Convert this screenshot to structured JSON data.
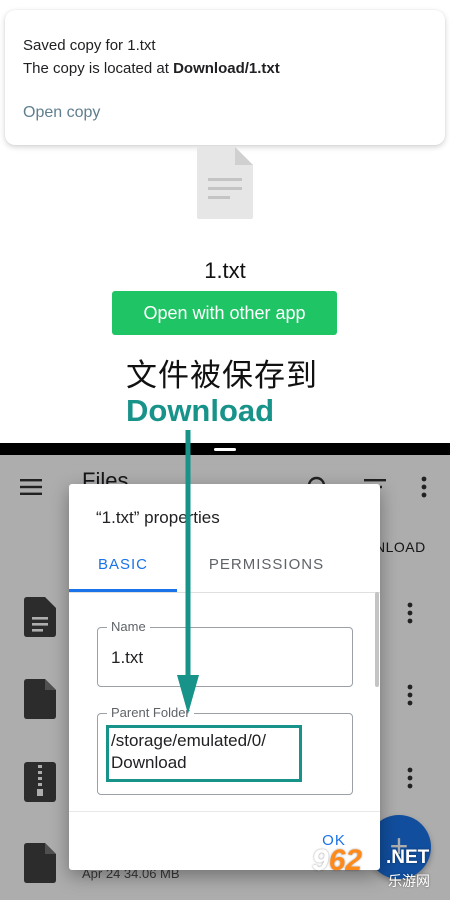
{
  "snackbar": {
    "title": "Saved copy for 1.txt",
    "message_prefix": "The copy is located at ",
    "message_location": "Download/1.txt",
    "action": "Open copy"
  },
  "preview": {
    "file_name": "1.txt",
    "open_button": "Open with other app"
  },
  "annotation": {
    "caption_cn": "文件被保存到",
    "caption_en": "Download",
    "color": "#17938a"
  },
  "files_app": {
    "title": "Files",
    "tab_partial": "NLOAD",
    "last_row_meta": "Apr 24    34.06 MB",
    "fab_label": "+",
    "icons": [
      "menu-icon",
      "search-icon",
      "sort-icon",
      "overflow-icon",
      "file-icon",
      "zip-icon"
    ]
  },
  "dialog": {
    "title": "“1.txt” properties",
    "tabs": {
      "basic": "BASIC",
      "permissions": "PERMISSIONS"
    },
    "name_label": "Name",
    "name_value": "1.txt",
    "parent_label": "Parent Folder",
    "parent_line1": "/storage/emulated/0/",
    "parent_line2": "Download",
    "ok": "OK"
  },
  "watermark": {
    "number_a": "9",
    "number_b": "62",
    "net": ".NET",
    "cn": "乐游网"
  },
  "colors": {
    "accent_green": "#1fc464",
    "annotation_teal": "#17938a",
    "primary_blue": "#1a73e8"
  }
}
